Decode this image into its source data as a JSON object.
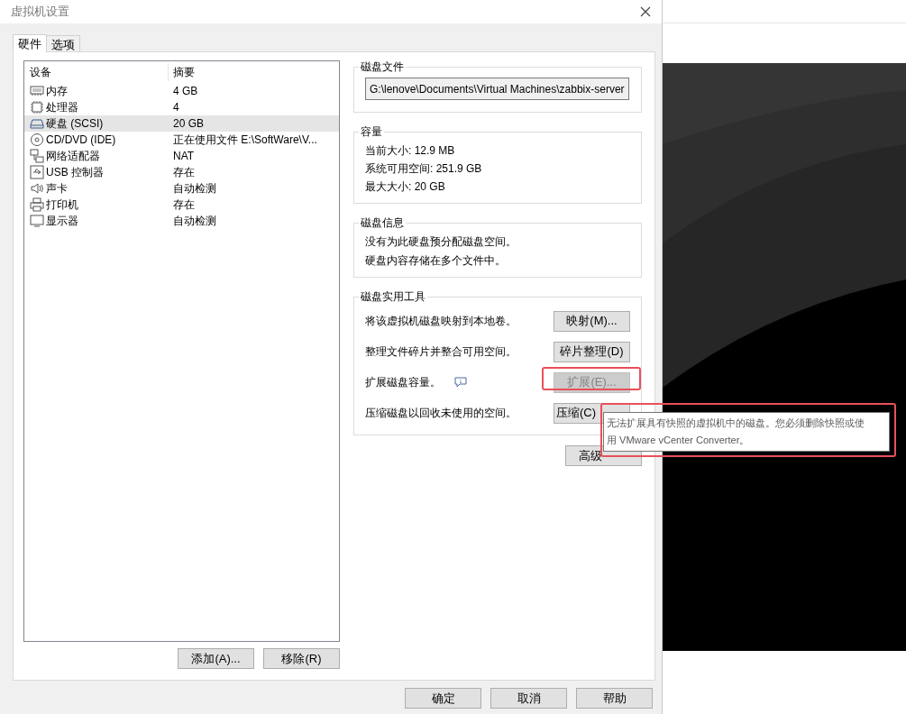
{
  "window": {
    "title": "虚拟机设置"
  },
  "tabs": [
    {
      "label": "硬件",
      "selected": true
    },
    {
      "label": "选项",
      "selected": false
    }
  ],
  "device_list": {
    "columns": [
      "设备",
      "摘要"
    ],
    "rows": [
      {
        "kind": "memory",
        "device": "内存",
        "summary": "4 GB",
        "selected": false
      },
      {
        "kind": "cpu",
        "device": "处理器",
        "summary": "4",
        "selected": false
      },
      {
        "kind": "disk",
        "device": "硬盘 (SCSI)",
        "summary": "20 GB",
        "selected": true
      },
      {
        "kind": "cdrom",
        "device": "CD/DVD (IDE)",
        "summary": "正在使用文件 E:\\SoftWare\\V...",
        "selected": false
      },
      {
        "kind": "network",
        "device": "网络适配器",
        "summary": "NAT",
        "selected": false
      },
      {
        "kind": "usb",
        "device": "USB 控制器",
        "summary": "存在",
        "selected": false
      },
      {
        "kind": "sound",
        "device": "声卡",
        "summary": "自动检测",
        "selected": false
      },
      {
        "kind": "printer",
        "device": "打印机",
        "summary": "存在",
        "selected": false
      },
      {
        "kind": "display",
        "device": "显示器",
        "summary": "自动检测",
        "selected": false
      }
    ]
  },
  "list_buttons": [
    "添加(A)...",
    "移除(R)"
  ],
  "disk_file": {
    "title": "磁盘文件",
    "value": "G:\\lenove\\Documents\\Virtual Machines\\zabbix-server"
  },
  "capacity": {
    "title": "容量",
    "lines": [
      "当前大小: 12.9 MB",
      "系统可用空间: 251.9 GB",
      "最大大小: 20 GB"
    ]
  },
  "disk_info": {
    "title": "磁盘信息",
    "lines": [
      "没有为此硬盘预分配磁盘空间。",
      "硬盘内容存储在多个文件中。"
    ]
  },
  "disk_utilities": {
    "title": "磁盘实用工具",
    "rows": [
      {
        "text": "将该虚拟机磁盘映射到本地卷。",
        "button": "映射(M)...",
        "disabled": false,
        "info_icon": false,
        "highlighted": false
      },
      {
        "text": "整理文件碎片并整合可用空间。",
        "button": "碎片整理(D)",
        "disabled": false,
        "info_icon": false,
        "highlighted": false
      },
      {
        "text": "扩展磁盘容量。",
        "button": "扩展(E)...",
        "disabled": true,
        "info_icon": true,
        "highlighted": true
      },
      {
        "text": "压缩磁盘以回收未使用的空间。",
        "button": "压缩(C)",
        "disabled": false,
        "info_icon": false,
        "highlighted": false
      }
    ]
  },
  "advanced_button": "高级",
  "tooltip": {
    "lines": [
      "无法扩展具有快照的虚拟机中的磁盘。您必须删除快照或使",
      "用 VMware vCenter Converter。"
    ],
    "highlighted": true
  },
  "dialog_buttons": [
    "确定",
    "取消",
    "帮助"
  ]
}
